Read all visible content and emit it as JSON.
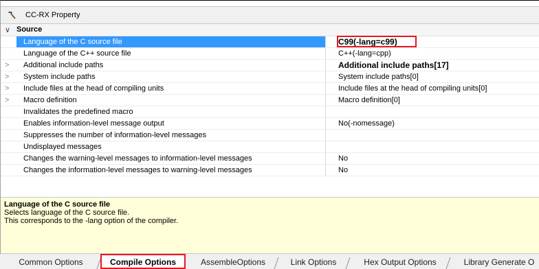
{
  "window": {
    "title": "CC-RX Property"
  },
  "section": {
    "label": "Source",
    "collapse_glyph": "∨"
  },
  "properties": [
    {
      "expander": "",
      "name": "Language of the C source file",
      "value": "C99(-lang=c99)",
      "selected": true,
      "bold": true
    },
    {
      "expander": "",
      "name": "Language of the C++ source file",
      "value": "C++(-lang=cpp)"
    },
    {
      "expander": ">",
      "name": "Additional include paths",
      "value": "Additional include paths[17]",
      "bold": true
    },
    {
      "expander": ">",
      "name": "System include paths",
      "value": "System include paths[0]"
    },
    {
      "expander": ">",
      "name": "Include files at the head of compiling units",
      "value": "Include files at the head of compiling units[0]"
    },
    {
      "expander": ">",
      "name": "Macro definition",
      "value": "Macro definition[0]"
    },
    {
      "expander": "",
      "name": "Invalidates the predefined macro",
      "value": ""
    },
    {
      "expander": "",
      "name": "Enables information-level message output",
      "value": "No(-nomessage)"
    },
    {
      "expander": "",
      "name": "Suppresses the number of information-level messages",
      "value": ""
    },
    {
      "expander": "",
      "name": "Undisplayed messages",
      "value": ""
    },
    {
      "expander": "",
      "name": "Changes the warning-level messages to information-level messages",
      "value": "No"
    },
    {
      "expander": "",
      "name": "Changes the information-level messages to warning-level messages",
      "value": "No"
    }
  ],
  "description": {
    "title": "Language of the C source file",
    "lines": [
      "Selects language of the C source file.",
      "This corresponds to the -lang option of the compiler."
    ]
  },
  "tabs": [
    {
      "label": "Common Options",
      "active": false
    },
    {
      "label": "Compile Options",
      "active": true
    },
    {
      "label": "AssembleOptions",
      "active": false
    },
    {
      "label": "Link Options",
      "active": false
    },
    {
      "label": "Hex Output Options",
      "active": false
    },
    {
      "label": "Library Generate O",
      "active": false
    }
  ],
  "colors": {
    "selection": "#3399ff",
    "highlight": "#e8141f",
    "description_bg": "#fffed8"
  },
  "icons": {
    "title": "hammer-icon",
    "collapse": "chevron-down-icon",
    "expander": "chevron-right-icon"
  }
}
